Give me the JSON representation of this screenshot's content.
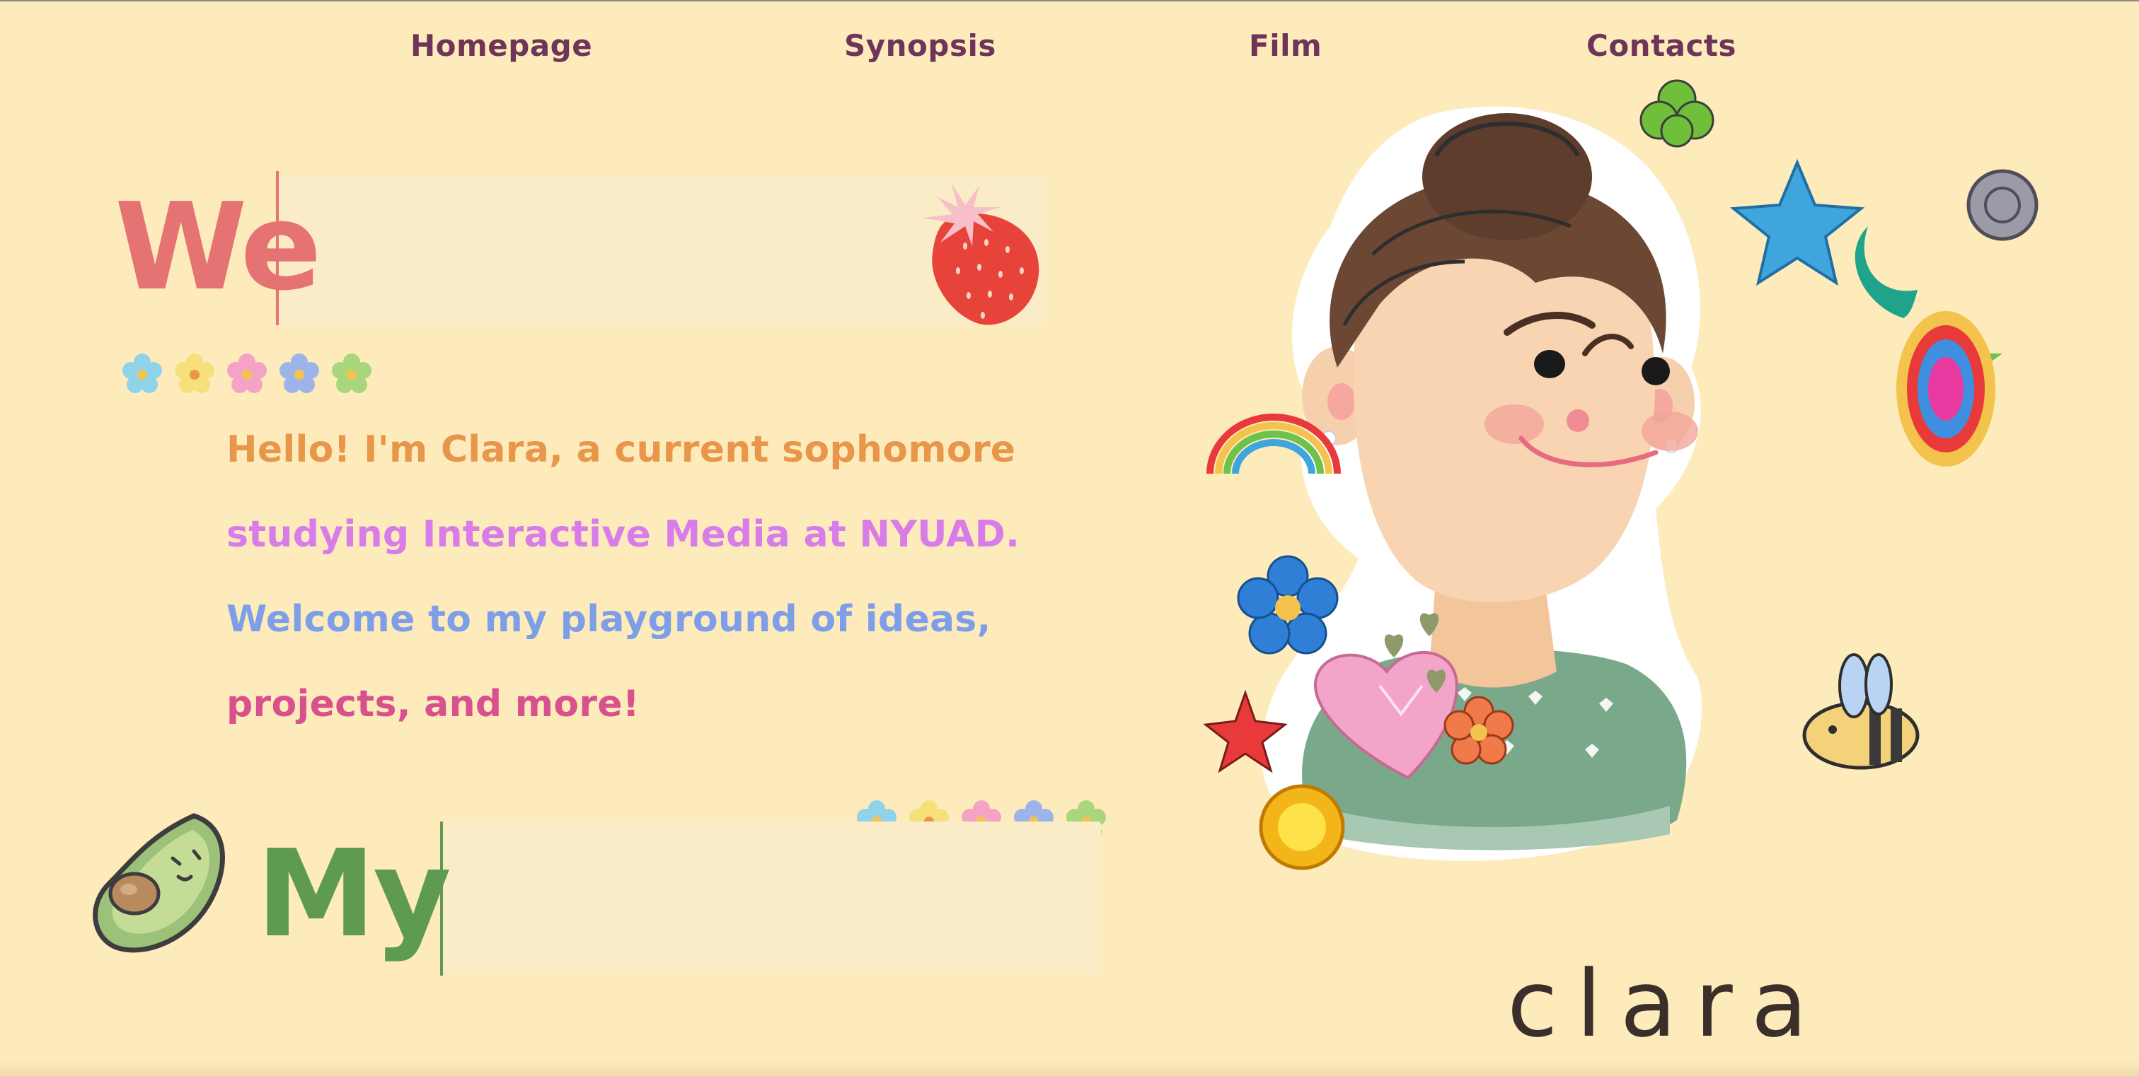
{
  "nav": {
    "items": [
      {
        "label": "Homepage"
      },
      {
        "label": "Synopsis"
      },
      {
        "label": "Film"
      },
      {
        "label": "Contacts"
      }
    ]
  },
  "hero": {
    "welcome_partial": "We",
    "my_partial": "My"
  },
  "intro": {
    "line1": "Hello! I'm Clara, a current sophomore",
    "line2": "studying Interactive Media at NYUAD.",
    "line3": "Welcome to my playground of ideas,",
    "line4": "projects, and more!"
  },
  "portrait": {
    "signature": "clara"
  },
  "colors": {
    "background": "#fdebbc",
    "nav": "#6e3559",
    "welcome": "#e57373",
    "my": "#5e9a52",
    "line1": "#e8964a",
    "line2": "#d77ce8",
    "line3": "#7f9ee8",
    "line4": "#d8508c"
  }
}
